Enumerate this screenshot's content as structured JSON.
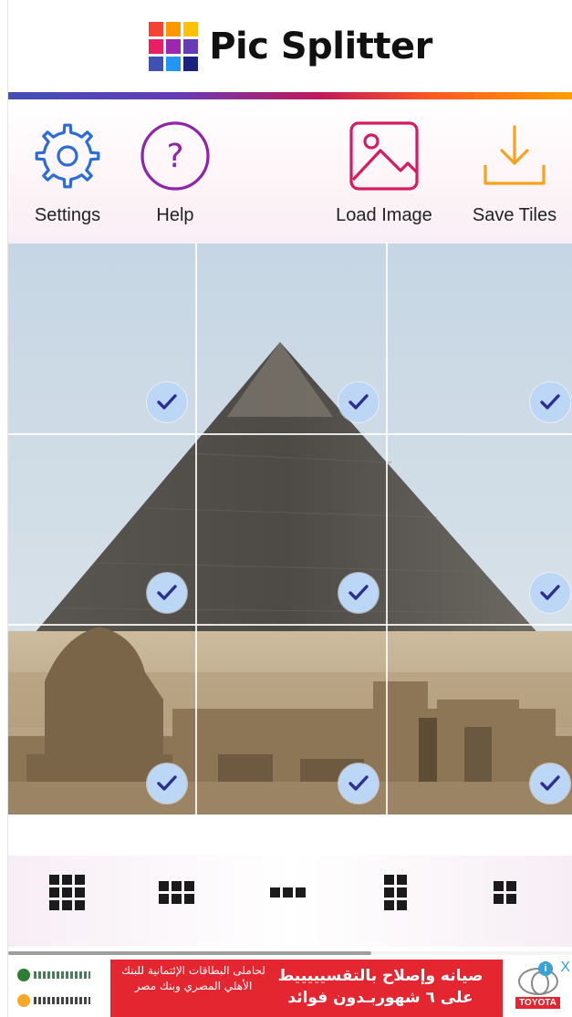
{
  "app": {
    "title": "Pic Splitter",
    "logo_colors": [
      "#f44336",
      "#ff9800",
      "#ffc107",
      "#e91e63",
      "#9c27b0",
      "#673ab7",
      "#3f51b5",
      "#2196f3",
      "#1a237e"
    ]
  },
  "toolbar": {
    "settings_label": "Settings",
    "help_label": "Help",
    "load_label": "Load Image",
    "save_label": "Save Tiles",
    "colors": {
      "settings": "#2b6cd6",
      "help": "#8e24aa",
      "load": "#d81b60",
      "save": "#f7a21b"
    }
  },
  "image": {
    "grid": {
      "rows": 3,
      "cols": 3
    },
    "tiles_selected": [
      true,
      true,
      true,
      true,
      true,
      true,
      true,
      true,
      true
    ],
    "check_color": "#2c2f8f"
  },
  "layout_options": [
    {
      "name": "grid-3x3",
      "rows": 3,
      "cols": 3
    },
    {
      "name": "grid-2x3",
      "rows": 2,
      "cols": 3
    },
    {
      "name": "grid-1x3",
      "rows": 1,
      "cols": 3
    },
    {
      "name": "grid-3x2",
      "rows": 3,
      "cols": 2
    },
    {
      "name": "grid-2x2",
      "rows": 2,
      "cols": 2
    }
  ],
  "ad": {
    "left_text": "لحاملى البطاقات الإئتمانية للبنك الأهلي المصري وبنك مصر",
    "right_line1": "صيانه وإصلاح بالتقسيييييط",
    "right_line2": "على ٦ شهوربـدون فوائد",
    "brand": "TOYOTA",
    "info_icon": "i",
    "close_icon": "X"
  }
}
